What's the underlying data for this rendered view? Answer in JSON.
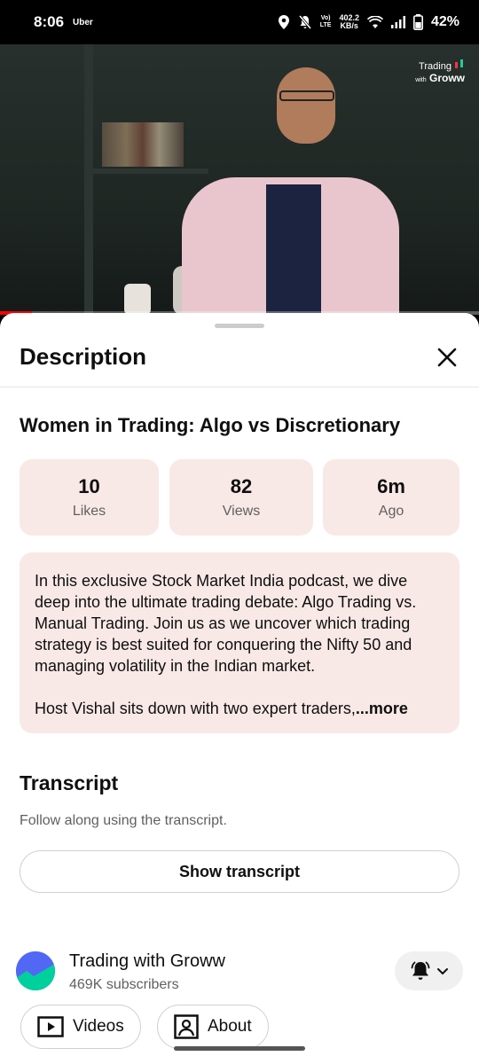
{
  "status_bar": {
    "time": "8:06",
    "app_label": "Uber",
    "volte_top": "Vo)",
    "volte_bottom": "LTE",
    "net_speed_value": "402.2",
    "net_speed_unit": "KB/s",
    "battery": "42%"
  },
  "video": {
    "brand_line1": "Trading",
    "brand_small": "with",
    "brand_line2": "Groww",
    "progress": 0.067
  },
  "sheet": {
    "title": "Description",
    "video_title": "Women in Trading: Algo vs Discretionary",
    "stats": [
      {
        "value": "10",
        "label": "Likes"
      },
      {
        "value": "82",
        "label": "Views"
      },
      {
        "value": "6m",
        "label": "Ago"
      }
    ],
    "description": {
      "paragraph1": "In this exclusive Stock Market India podcast, we dive deep into the ultimate trading debate: Algo Trading vs. Manual Trading. Join us as we uncover which trading strategy is best suited for conquering the Nifty 50 and managing volatility in the Indian market.",
      "paragraph2": "Host Vishal sits down with two expert traders,",
      "more": "...more"
    },
    "transcript": {
      "title": "Transcript",
      "subtitle": "Follow along using the transcript.",
      "button": "Show transcript"
    },
    "channel": {
      "name": "Trading with Groww",
      "subscribers": "469K subscribers"
    },
    "chips": [
      "Videos",
      "About"
    ]
  },
  "icons": [
    "location-icon",
    "mute-icon",
    "wifi-icon",
    "signal-icon",
    "battery-icon",
    "close-icon",
    "bell-icon",
    "chevron-down-icon",
    "video-icon",
    "about-icon"
  ],
  "colors": {
    "accent_bg": "#f8e9e6",
    "progress": "#ff0000"
  }
}
